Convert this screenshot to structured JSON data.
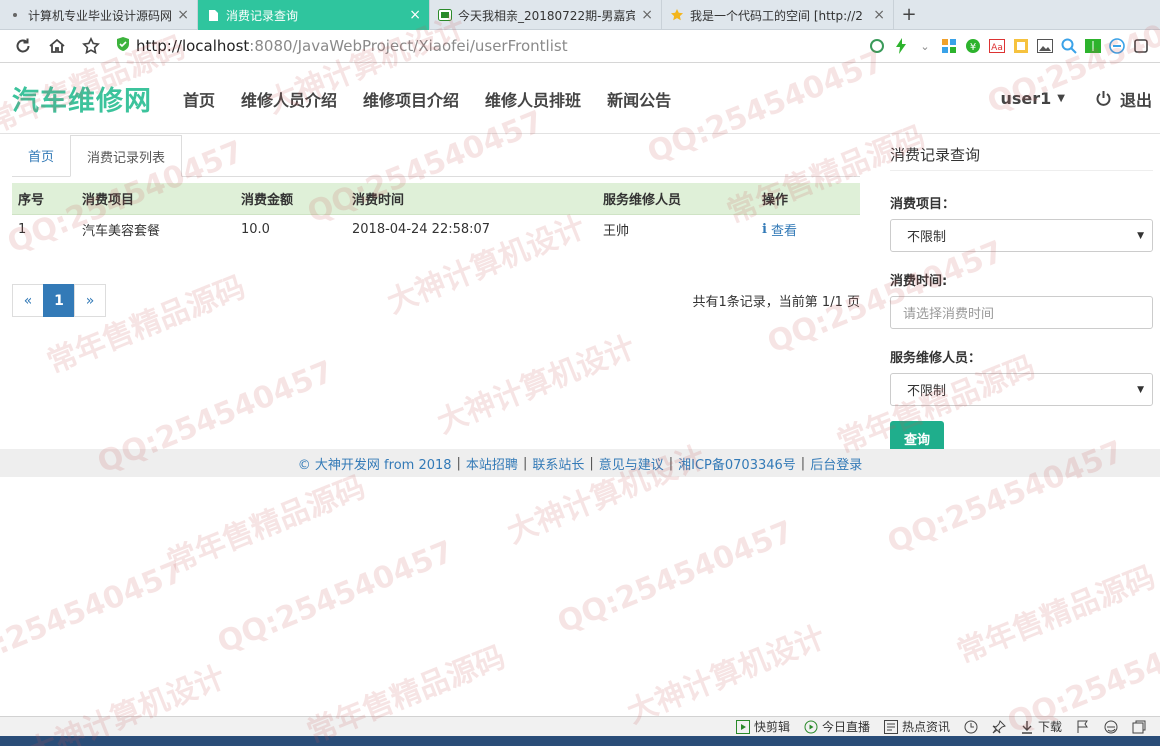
{
  "browser": {
    "tabs": [
      {
        "title": "计算机专业毕业设计源码网",
        "active": false
      },
      {
        "title": "消费记录查询",
        "active": true
      },
      {
        "title": "今天我相亲_20180722期-男嘉宾",
        "active": false
      },
      {
        "title": "我是一个代码工的空间 [http://2",
        "active": false
      }
    ],
    "new_tab": "+",
    "url_host": "http://localhost",
    "url_path": ":8080/JavaWebProject/Xiaofei/userFrontlist"
  },
  "site": {
    "brand": "汽车维修网",
    "nav": [
      "首页",
      "维修人员介绍",
      "维修项目介绍",
      "维修人员排班",
      "新闻公告"
    ],
    "user": "user1",
    "logout": "退出"
  },
  "main": {
    "breadcrumb": {
      "home": "首页",
      "current": "消费记录列表"
    },
    "table": {
      "headers": [
        "序号",
        "消费项目",
        "消费金额",
        "消费时间",
        "服务维修人员",
        "操作"
      ],
      "rows": [
        {
          "idx": "1",
          "item": "汽车美容套餐",
          "amount": "10.0",
          "time": "2018-04-24 22:58:07",
          "staff": "王帅",
          "op": "查看"
        }
      ]
    },
    "pagination": {
      "prev": "«",
      "current": "1",
      "next": "»"
    },
    "summary": "共有1条记录，当前第 1/1 页"
  },
  "sidebar": {
    "title": "消费记录查询",
    "item_label": "消费项目：",
    "item_value": "不限制",
    "time_label": "消费时间:",
    "time_placeholder": "请选择消费时间",
    "staff_label": "服务维修人员：",
    "staff_value": "不限制",
    "search_btn": "查询"
  },
  "footer": {
    "copyright": "© 大神开发网 from 2018",
    "links": [
      "本站招聘",
      "联系站长",
      "意见与建议",
      "湘ICP备0703346号",
      "后台登录"
    ]
  },
  "statusbar": [
    "快剪辑",
    "今日直播",
    "热点资讯",
    "下载"
  ],
  "watermarks": [
    "QQ:254540457",
    "大神计算机设计",
    "常年售精品源码"
  ],
  "colors": {
    "brand": "#3cc39c",
    "active_tab": "#2fc59e",
    "link": "#337ab7",
    "table_head": "#dff0d8",
    "search_btn": "#1fae8c"
  }
}
